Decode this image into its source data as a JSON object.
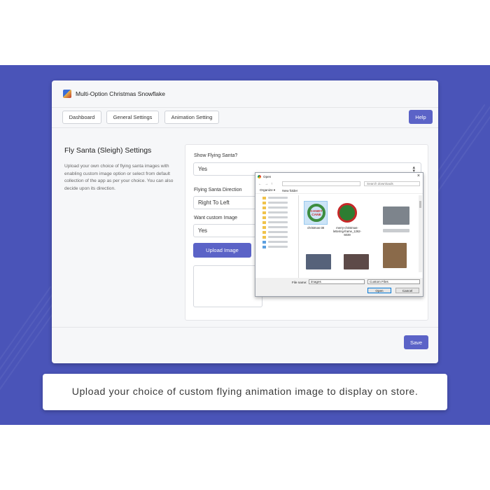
{
  "app": {
    "title": "Multi-Option Christmas Snowflake"
  },
  "nav": {
    "tabs": [
      "Dashboard",
      "General Settings",
      "Animation Setting"
    ],
    "help_label": "Help"
  },
  "section": {
    "title": "Fly Santa (Sleigh) Settings",
    "description": "Upload your own choice of flying santa images with enabling custom image option or select from default collection of the app as per your choice. You can also decide upon its direction."
  },
  "form": {
    "show_label": "Show Flying Santa?",
    "show_value": "Yes",
    "direction_label": "Flying Santa Direction",
    "direction_value": "Right To Left",
    "custom_label": "Want custom Image",
    "custom_value": "Yes",
    "upload_label": "Upload Image",
    "save_label": "Save"
  },
  "dialog": {
    "title": "Open",
    "search_placeholder": "Search downloads",
    "organize_label": "Organize ▾",
    "new_folder_label": "New folder",
    "files": [
      {
        "name": "christmas-38"
      },
      {
        "name": "merry-christmas-lettering-frame_1262-6039"
      }
    ],
    "thumb1_text": "CANDY CANE",
    "file_name_label": "File name:",
    "file_name_value": "images",
    "file_type_value": "Custom Files",
    "open_label": "Open",
    "cancel_label": "Cancel"
  },
  "caption": "Upload your choice of custom flying animation image to display on store.",
  "colors": {
    "background": "#4a54b8",
    "accent": "#5b63c7"
  }
}
